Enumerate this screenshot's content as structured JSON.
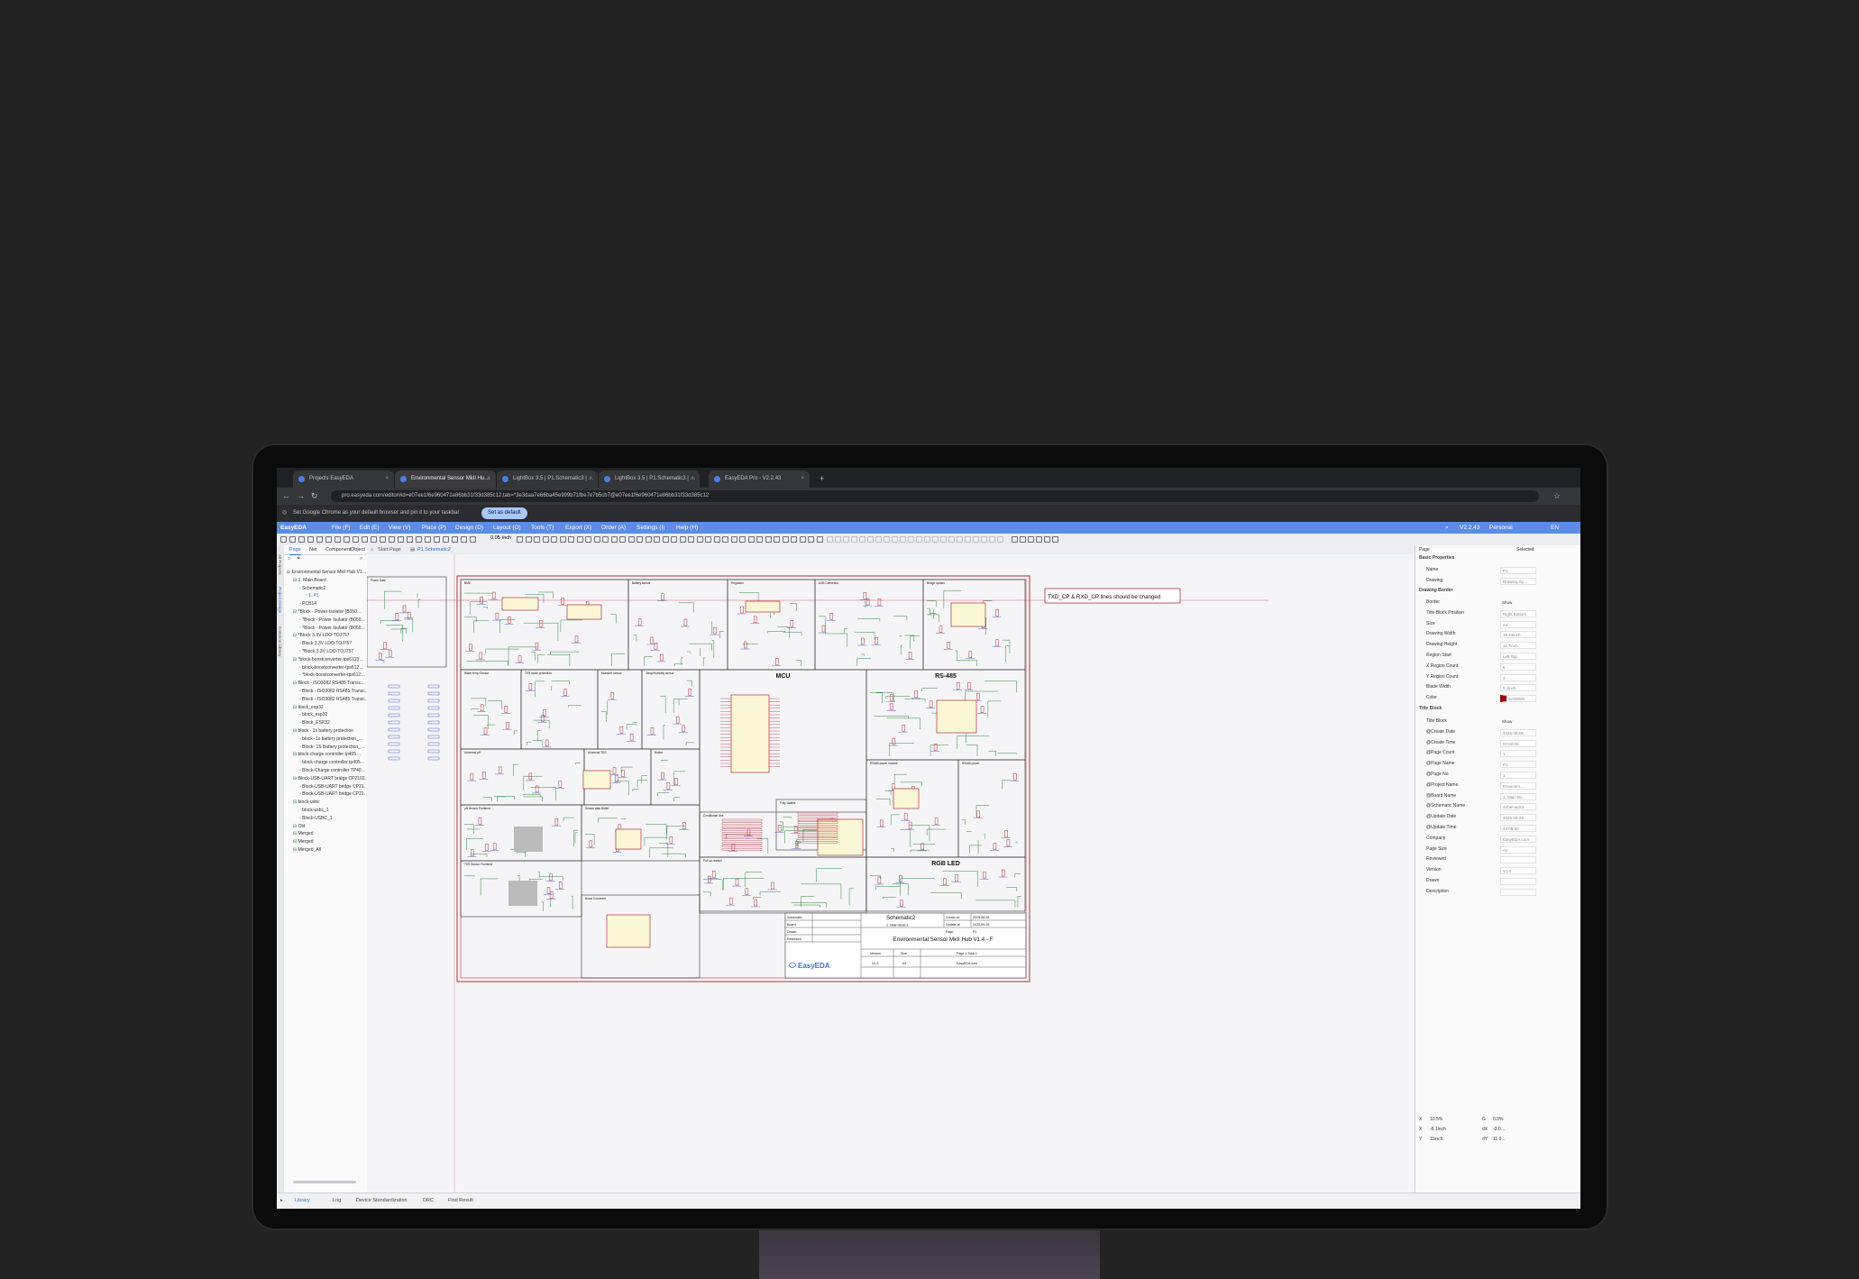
{
  "browser": {
    "tabs": [
      {
        "label": "Projects EasyEDA",
        "active": false
      },
      {
        "label": "Environmental Sensor MkII Hu…",
        "active": true
      },
      {
        "label": "LightBox 3.5 | P1.Schematic3 | …",
        "active": false
      },
      {
        "label": "LightBox 3.5 | P1.Schematic3 | …",
        "active": false
      },
      {
        "label": "EasyEDA Pro - V2.2.43",
        "active": false
      }
    ],
    "new_tab_label": "+",
    "url": "pro.easyeda.com/editor#id=e07ee1f6e960471e86bb31f33d385c12,tab=*3e3daa7e66ba45e999b71fbe7e7b5cb7@e07ee1f6e960471e86bb31f33d385c12",
    "infobar_text": "Set Google Chrome as your default browser and pin it to your taskbar",
    "infobar_button": "Set as default"
  },
  "app": {
    "logo": "EasyEDA",
    "menu": [
      "File (F)",
      "Edit (E)",
      "View (V)",
      "Place (P)",
      "Design (D)",
      "Layout (O)",
      "Tools (T)",
      "Export (X)",
      "Order (A)",
      "Settings (I)",
      "Help (H)"
    ],
    "version": "V2.2.43",
    "mode": "Personal",
    "lang": "EN",
    "zoom": "0.05",
    "unit": "inch"
  },
  "left_panel": {
    "vertical_tabs": [
      "All Projects",
      "Project Design",
      "Common Library"
    ],
    "tabs": [
      "Page",
      "Net",
      "Component",
      "Object"
    ],
    "tree": [
      {
        "label": "Environmental Sensor MkII Hub V1…",
        "level": 0
      },
      {
        "label": "1. Main Board",
        "level": 1
      },
      {
        "label": "Schematic2",
        "level": 2
      },
      {
        "label": "1. P1",
        "level": 3
      },
      {
        "label": "PCB14",
        "level": 2
      },
      {
        "label": "*Block - Power Isolator (B050…",
        "level": 1
      },
      {
        "label": "*Block - Power Isolator (B050…",
        "level": 2
      },
      {
        "label": "*Block - Power Isolator (B050…",
        "level": 2
      },
      {
        "label": "*Block 3.3V LDO-TOJ757",
        "level": 1
      },
      {
        "label": "Block 3.3V LDO-TOJ757",
        "level": 2
      },
      {
        "label": "*Block 3.3V LDO-TOJ757",
        "level": 2
      },
      {
        "label": "*block-boostconverter-tps6123…",
        "level": 1
      },
      {
        "label": "block-boostconverter-tps612…",
        "level": 2
      },
      {
        "label": "*block-boostconverter-tps612…",
        "level": 2
      },
      {
        "label": "Block - ISO3082 RS485 Transc…",
        "level": 1
      },
      {
        "label": "Block - ISO3082 RS485 Transc…",
        "level": 2
      },
      {
        "label": "Block - ISO3082 RS485 Transc…",
        "level": 2
      },
      {
        "label": "block_esp32",
        "level": 1
      },
      {
        "label": "block_esp32",
        "level": 2
      },
      {
        "label": "Block_ESP32",
        "level": 2
      },
      {
        "label": "block - 1s battery protection",
        "level": 1
      },
      {
        "label": "block- 1s battery protection_…",
        "level": 2
      },
      {
        "label": "Block- 1S Battery protection_…",
        "level": 2
      },
      {
        "label": "block-charge controller tp405…",
        "level": 1
      },
      {
        "label": "block-charge controller tp405…",
        "level": 2
      },
      {
        "label": "Block-Charge controller TP40…",
        "level": 2
      },
      {
        "label": "Block-USB-UART bridge CP2102…",
        "level": 1
      },
      {
        "label": "Block-USB-UART bridge CP21…",
        "level": 2
      },
      {
        "label": "Block-USB-UART bridge CP21…",
        "level": 2
      },
      {
        "label": "block-usbc",
        "level": 1
      },
      {
        "label": "block-usbc_1",
        "level": 2
      },
      {
        "label": "Block-USBC_1",
        "level": 2
      },
      {
        "label": "Old",
        "level": 1
      },
      {
        "label": "Merged",
        "level": 1
      },
      {
        "label": "Merged",
        "level": 1
      },
      {
        "label": "Merged_All",
        "level": 1
      }
    ]
  },
  "doc_tabs": [
    "Start Page",
    "P1.Schematic2"
  ],
  "schematic": {
    "blocks": [
      "Power Gate",
      "BMS",
      "Battery sensor",
      "Regulator",
      "USB Connector",
      "Bridge system",
      "Water temp Sensor",
      "TVS diode protection",
      "Moisture sensor",
      "Temp/Humidity sensor",
      "MCU",
      "RS-485",
      "Universal pH",
      "Universal TDS",
      "Button",
      "RS485 power Isolator",
      "RS485 power",
      "pH Sensor Frontend",
      "Sensor data Buffer",
      "Conditional Use",
      "Fully Usable",
      "TDS Sensor Frontend",
      "Boost Converter",
      "Pull up resistor",
      "RGB LED"
    ],
    "callout": "TXD_CP & RXD_CP lines should be changed",
    "title_block": {
      "sheet_label": "Schematic",
      "sheet_value": "Schematic2",
      "board_label": "Board",
      "board_value": "1. Main Board",
      "drawn_label": "Drawn",
      "reviewed_label": "Reviewed",
      "create_label": "Create at",
      "create_value": "2025-08-05",
      "update_label": "Update at",
      "update_value": "2025-09-25",
      "page_label": "Page",
      "page_value": "P1",
      "title": "Environmental Sensor MkII Hub V1.4 - F",
      "version_label": "Version",
      "version_value": "V1.0",
      "size_label": "Size",
      "size_value": "A4",
      "page_count": "Page  1  Total  1",
      "company": "EasyEDA.com",
      "logo": "EasyEDA"
    }
  },
  "right_panel": {
    "header_left": "Page",
    "header_right": "Selected",
    "sections": {
      "basic": "Basic Properties",
      "border": "Drawing Border",
      "title": "Title Block"
    },
    "basic_props": [
      {
        "label": "Name",
        "value": "P1"
      },
      {
        "label": "Drawing",
        "value": "Drawing Sy…"
      }
    ],
    "border_props": [
      {
        "label": "Border",
        "value": "Show"
      },
      {
        "label": "Title Block Position",
        "value": "Right Bottom"
      },
      {
        "label": "Size",
        "value": "A4"
      },
      {
        "label": "Drawing Width",
        "value": "16.53inch"
      },
      {
        "label": "Drawing Height",
        "value": "11.7inch"
      },
      {
        "label": "Region Start",
        "value": "Left Top"
      },
      {
        "label": "X Region Count",
        "value": "6"
      },
      {
        "label": "Y Region Count",
        "value": "4"
      },
      {
        "label": "Blade Width",
        "value": "0.1inch"
      },
      {
        "label": "Color",
        "value": "#A00000"
      }
    ],
    "title_props": [
      {
        "label": "Title Block",
        "value": "Show"
      },
      {
        "label": "@Create Date",
        "value": "2025-08-05"
      },
      {
        "label": "@Create Time",
        "value": "07:02:09"
      },
      {
        "label": "@Page Count",
        "value": "1"
      },
      {
        "label": "@Page Name",
        "value": "P1"
      },
      {
        "label": "@Page No",
        "value": "1"
      },
      {
        "label": "@Project Name",
        "value": "Environm…"
      },
      {
        "label": "@Board Name",
        "value": "1. Main Bo…"
      },
      {
        "label": "@Schematic Name",
        "value": "Schematic2"
      },
      {
        "label": "@Update Date",
        "value": "2025-09-25"
      },
      {
        "label": "@Update Time",
        "value": "23:05:20"
      },
      {
        "label": "Company",
        "value": "EasyEDA.com"
      },
      {
        "label": "Page Size",
        "value": "A4"
      },
      {
        "label": "Reviewed",
        "value": ""
      },
      {
        "label": "Version",
        "value": "V1.0"
      },
      {
        "label": "Drawn",
        "value": ""
      },
      {
        "label": "Description",
        "value": ""
      }
    ],
    "coords": [
      {
        "label": "X",
        "value": "10.5%",
        "label2": "G",
        "value2": "0.0%"
      },
      {
        "label": "X",
        "value": "-6.1inch",
        "label2": "dX",
        "value2": "-0.0…"
      },
      {
        "label": "Y",
        "value": "11inch",
        "label2": "dY",
        "value2": "11.0…"
      }
    ]
  },
  "status_tabs": [
    "Library",
    "Log",
    "Device Standardization",
    "DRC",
    "Find Result"
  ],
  "colors": {
    "accent": "#5a8ee6",
    "border": "#b3303a",
    "wire": "#2f8a3a",
    "label": "#2b3fd6",
    "body": "#202020"
  }
}
